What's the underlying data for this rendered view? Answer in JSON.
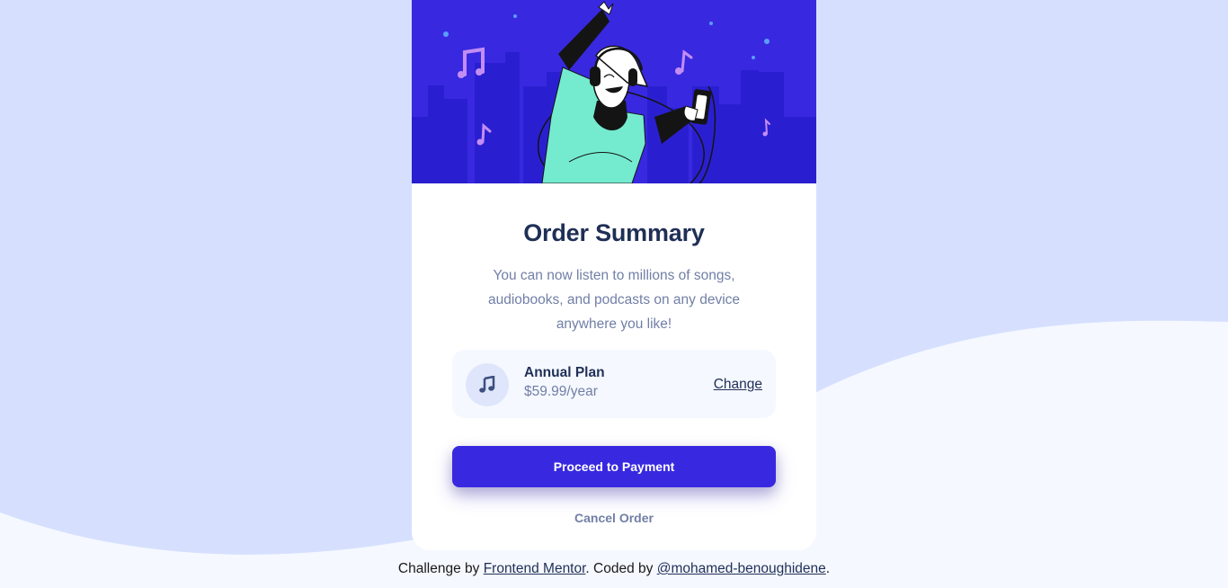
{
  "colors": {
    "page_bg": "#d6e0fe",
    "wave": "#f5f8ff",
    "hero_bg": "#3829e0",
    "card_bg": "#ffffff",
    "heading": "#1f2f56",
    "body_text": "#717fa6",
    "primary_button": "#3829e0",
    "plan_bg": "#f5f8ff",
    "plan_icon_bg": "#dfe6fb"
  },
  "hero": {
    "illustration": "illustration-hero"
  },
  "card": {
    "title": "Order Summary",
    "description": "You can now listen to millions of songs, audiobooks, and podcasts on any device anywhere you like!"
  },
  "plan": {
    "icon": "music-note-icon",
    "name": "Annual Plan",
    "price": "$59.99/year",
    "change_label": "Change"
  },
  "actions": {
    "proceed_label": "Proceed to Payment",
    "cancel_label": "Cancel Order"
  },
  "attribution": {
    "prefix": "Challenge by ",
    "link1": "Frontend Mentor",
    "middle": ". Coded by ",
    "link2": "@mohamed-benoughidene",
    "suffix": "."
  }
}
